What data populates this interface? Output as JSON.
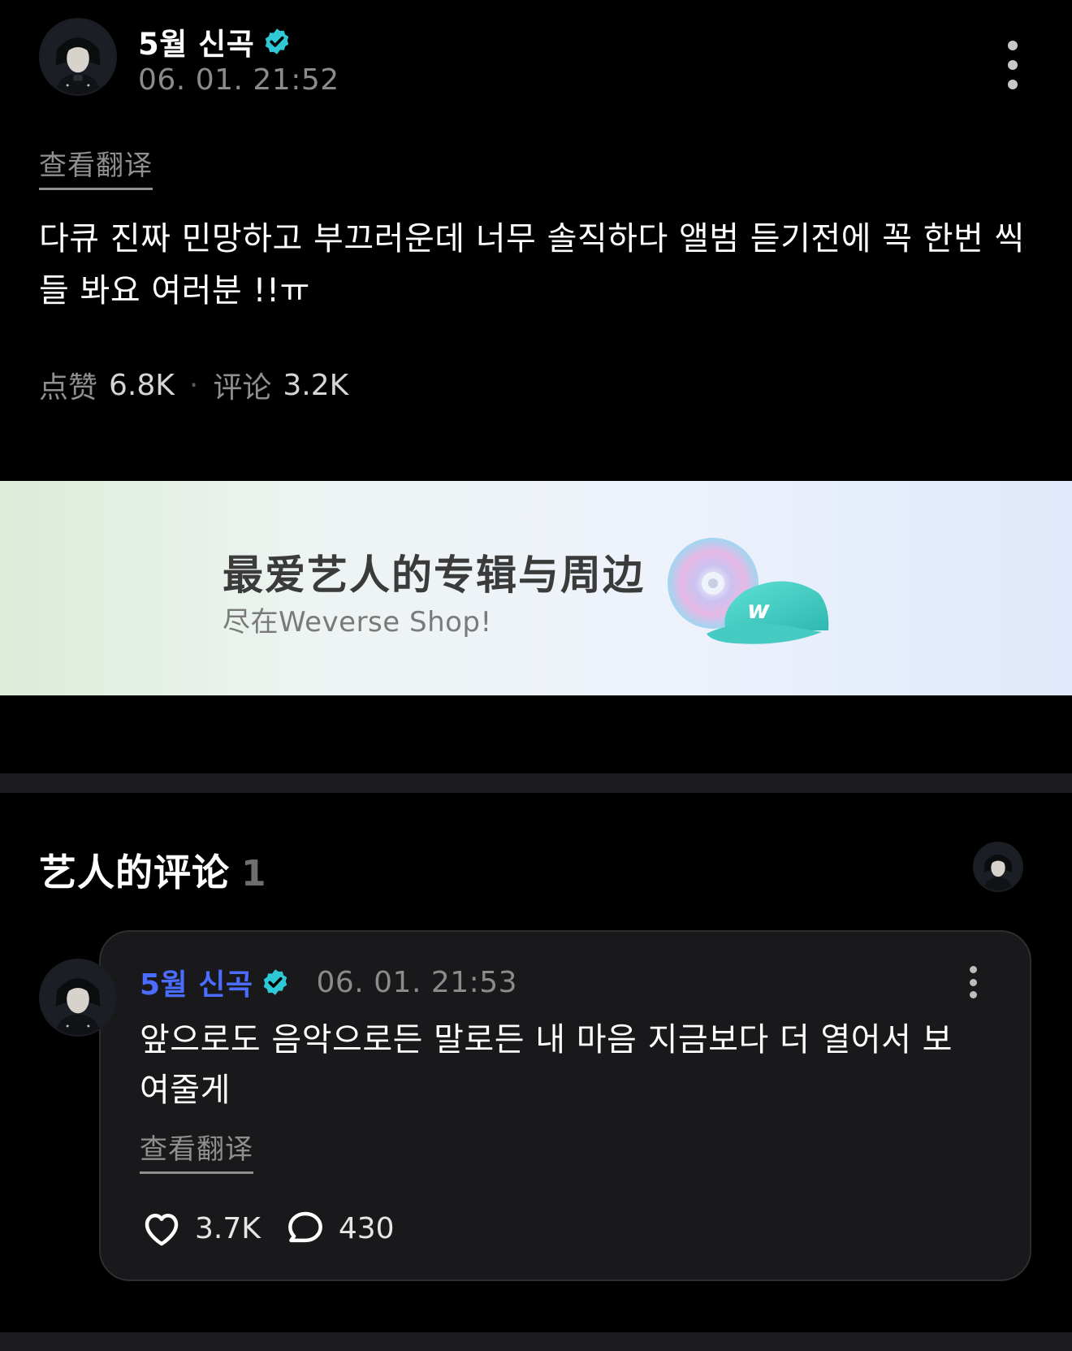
{
  "post": {
    "author": "5월 신곡",
    "timestamp": "06. 01. 21:52",
    "translate_label": "查看翻译",
    "body": "다큐 진짜 민망하고 부끄러운데 너무 솔직하다 앨범 듣기전에 꼭 한번 씩들 봐요 여러분 !!ㅠ",
    "likes_label": "点赞",
    "likes_count": "6.8K",
    "separator": "·",
    "comments_label": "评论",
    "comments_count": "3.2K"
  },
  "banner": {
    "title": "最爱艺人的专辑与周边",
    "subtitle": "尽在Weverse Shop!"
  },
  "artist_comments": {
    "title": "艺人的评论",
    "count": "1",
    "comment": {
      "author": "5월 신곡",
      "timestamp": "06. 01. 21:53",
      "body": "앞으로도 음악으로든 말로든 내 마음 지금보다 더 열어서 보여줄게",
      "translate_label": "查看翻译",
      "likes": "3.7K",
      "replies": "430"
    }
  },
  "icons": {
    "verified": "verified-badge-icon",
    "more": "more-vertical-icon",
    "heart": "heart-icon",
    "comment": "comment-bubble-icon"
  },
  "colors": {
    "background": "#000000",
    "verified": "#2ec8d6",
    "comment_author": "#4a6cff",
    "muted_text": "#8b8b8b",
    "card": "#19191b"
  }
}
